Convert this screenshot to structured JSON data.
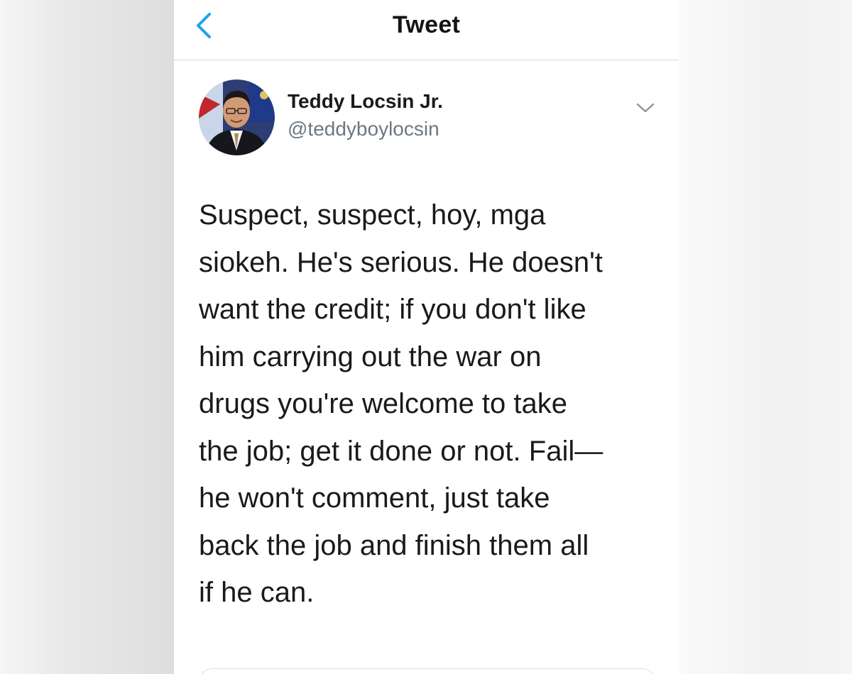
{
  "nav": {
    "back_icon": "chevron-left-icon",
    "title": "Tweet"
  },
  "author": {
    "display_name": "Teddy Locsin Jr.",
    "handle": "@teddyboylocsin",
    "avatar": "profile-photo",
    "menu_icon": "chevron-down-icon"
  },
  "tweet": {
    "lines": [
      "Suspect, suspect, hoy, mga",
      "siokeh. He's serious. He doesn't",
      "want the credit; if you don't like",
      "him carrying out the war on",
      "drugs you're welcome to take",
      "the job; get it done or not. Fail—",
      "he won't comment, just take",
      "back the job and finish them all",
      "if he can."
    ]
  },
  "colors": {
    "accent": "#1da1f2",
    "text_primary": "#1a1a1a",
    "text_secondary": "#6d7882",
    "divider": "#d6d6d6"
  }
}
